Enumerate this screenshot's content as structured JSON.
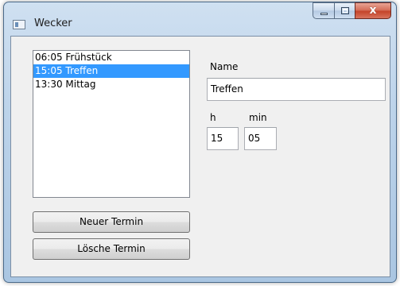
{
  "window": {
    "title": "Wecker",
    "icon": "app-window-icon",
    "controls": {
      "minimize": "minimize-icon",
      "maximize": "maximize-icon",
      "close": "x"
    }
  },
  "appointments": {
    "items": [
      {
        "label": "06:05 Frühstück",
        "selected": false
      },
      {
        "label": "15:05 Treffen",
        "selected": true
      },
      {
        "label": "13:30 Mittag",
        "selected": false
      }
    ]
  },
  "buttons": {
    "new_label": "Neuer Termin",
    "delete_label": "Lösche Termin"
  },
  "details": {
    "name_label": "Name",
    "name_value": "Treffen",
    "hour_label": "h",
    "hour_value": "15",
    "minute_label": "min",
    "minute_value": "05"
  },
  "colors": {
    "selection": "#3399ff",
    "close_button": "#c5442a"
  }
}
